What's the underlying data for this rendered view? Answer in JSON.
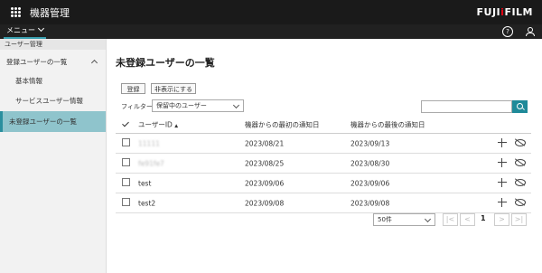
{
  "header": {
    "app_title": "機器管理",
    "brand_a": "FUJI",
    "brand_i": "i",
    "brand_b": "FILM"
  },
  "menubar": {
    "menu_label": "メニュー",
    "help_glyph": "?"
  },
  "sidebar": {
    "section": "ユーザー管理",
    "group": "登録ユーザーの一覧",
    "items": [
      "基本情報",
      "サービスユーザー情報"
    ],
    "active": "未登録ユーザーの一覧"
  },
  "main": {
    "title": "未登録ユーザーの一覧",
    "register_button": "登録",
    "hide_button": "非表示にする",
    "filter_label": "フィルター:",
    "filter_value": "保留中のユーザー",
    "search_value": ""
  },
  "table": {
    "columns": [
      "ユーザーID",
      "機器からの最初の通知日",
      "機器からの最後の通知日"
    ],
    "sort_indicator": "▲",
    "rows": [
      {
        "id": "11111",
        "first": "2023/08/21",
        "last": "2023/09/13"
      },
      {
        "id": "fe91fe7",
        "first": "2023/08/25",
        "last": "2023/08/30"
      },
      {
        "id": "test",
        "first": "2023/09/06",
        "last": "2023/09/06"
      },
      {
        "id": "test2",
        "first": "2023/09/08",
        "last": "2023/09/08"
      }
    ]
  },
  "pagination": {
    "per_page": "50件",
    "first": "|<",
    "prev": "<",
    "current": "1",
    "next": ">",
    "last": ">|"
  },
  "colors": {
    "accent": "#1f8a99",
    "active_bg": "#8fc4cc",
    "topbar": "#1a1a1a",
    "brand_red": "#e60012"
  }
}
